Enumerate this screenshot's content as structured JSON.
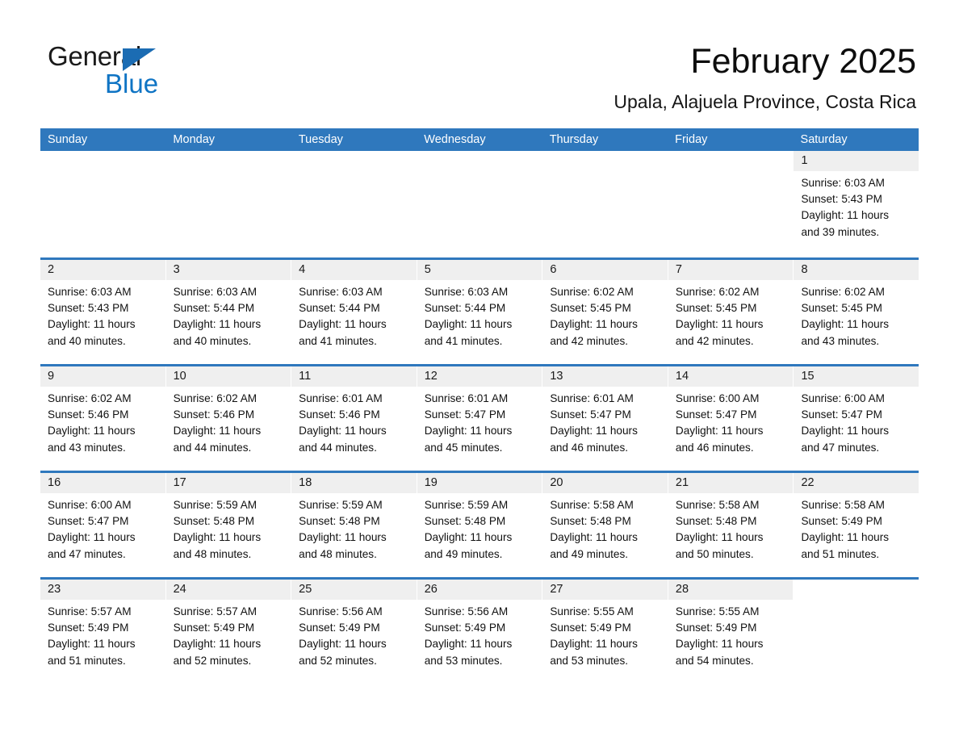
{
  "brand": {
    "name_part1": "General",
    "name_part2": "Blue",
    "triangle_icon": "triangle-icon",
    "accent_color": "#1b6cb3",
    "blue_text_color": "#0f74c4"
  },
  "header": {
    "month_title": "February 2025",
    "location": "Upala, Alajuela Province, Costa Rica"
  },
  "theme": {
    "header_blue": "#2f78bd",
    "day_band_gray": "#efefef",
    "cell_white": "#ffffff",
    "text_color": "#1a1a1a"
  },
  "weekdays": [
    "Sunday",
    "Monday",
    "Tuesday",
    "Wednesday",
    "Thursday",
    "Friday",
    "Saturday"
  ],
  "weeks": [
    [
      {
        "day": "",
        "lines": []
      },
      {
        "day": "",
        "lines": []
      },
      {
        "day": "",
        "lines": []
      },
      {
        "day": "",
        "lines": []
      },
      {
        "day": "",
        "lines": []
      },
      {
        "day": "",
        "lines": []
      },
      {
        "day": "1",
        "lines": [
          "Sunrise: 6:03 AM",
          "Sunset: 5:43 PM",
          "Daylight: 11 hours",
          "and 39 minutes."
        ]
      }
    ],
    [
      {
        "day": "2",
        "lines": [
          "Sunrise: 6:03 AM",
          "Sunset: 5:43 PM",
          "Daylight: 11 hours",
          "and 40 minutes."
        ]
      },
      {
        "day": "3",
        "lines": [
          "Sunrise: 6:03 AM",
          "Sunset: 5:44 PM",
          "Daylight: 11 hours",
          "and 40 minutes."
        ]
      },
      {
        "day": "4",
        "lines": [
          "Sunrise: 6:03 AM",
          "Sunset: 5:44 PM",
          "Daylight: 11 hours",
          "and 41 minutes."
        ]
      },
      {
        "day": "5",
        "lines": [
          "Sunrise: 6:03 AM",
          "Sunset: 5:44 PM",
          "Daylight: 11 hours",
          "and 41 minutes."
        ]
      },
      {
        "day": "6",
        "lines": [
          "Sunrise: 6:02 AM",
          "Sunset: 5:45 PM",
          "Daylight: 11 hours",
          "and 42 minutes."
        ]
      },
      {
        "day": "7",
        "lines": [
          "Sunrise: 6:02 AM",
          "Sunset: 5:45 PM",
          "Daylight: 11 hours",
          "and 42 minutes."
        ]
      },
      {
        "day": "8",
        "lines": [
          "Sunrise: 6:02 AM",
          "Sunset: 5:45 PM",
          "Daylight: 11 hours",
          "and 43 minutes."
        ]
      }
    ],
    [
      {
        "day": "9",
        "lines": [
          "Sunrise: 6:02 AM",
          "Sunset: 5:46 PM",
          "Daylight: 11 hours",
          "and 43 minutes."
        ]
      },
      {
        "day": "10",
        "lines": [
          "Sunrise: 6:02 AM",
          "Sunset: 5:46 PM",
          "Daylight: 11 hours",
          "and 44 minutes."
        ]
      },
      {
        "day": "11",
        "lines": [
          "Sunrise: 6:01 AM",
          "Sunset: 5:46 PM",
          "Daylight: 11 hours",
          "and 44 minutes."
        ]
      },
      {
        "day": "12",
        "lines": [
          "Sunrise: 6:01 AM",
          "Sunset: 5:47 PM",
          "Daylight: 11 hours",
          "and 45 minutes."
        ]
      },
      {
        "day": "13",
        "lines": [
          "Sunrise: 6:01 AM",
          "Sunset: 5:47 PM",
          "Daylight: 11 hours",
          "and 46 minutes."
        ]
      },
      {
        "day": "14",
        "lines": [
          "Sunrise: 6:00 AM",
          "Sunset: 5:47 PM",
          "Daylight: 11 hours",
          "and 46 minutes."
        ]
      },
      {
        "day": "15",
        "lines": [
          "Sunrise: 6:00 AM",
          "Sunset: 5:47 PM",
          "Daylight: 11 hours",
          "and 47 minutes."
        ]
      }
    ],
    [
      {
        "day": "16",
        "lines": [
          "Sunrise: 6:00 AM",
          "Sunset: 5:47 PM",
          "Daylight: 11 hours",
          "and 47 minutes."
        ]
      },
      {
        "day": "17",
        "lines": [
          "Sunrise: 5:59 AM",
          "Sunset: 5:48 PM",
          "Daylight: 11 hours",
          "and 48 minutes."
        ]
      },
      {
        "day": "18",
        "lines": [
          "Sunrise: 5:59 AM",
          "Sunset: 5:48 PM",
          "Daylight: 11 hours",
          "and 48 minutes."
        ]
      },
      {
        "day": "19",
        "lines": [
          "Sunrise: 5:59 AM",
          "Sunset: 5:48 PM",
          "Daylight: 11 hours",
          "and 49 minutes."
        ]
      },
      {
        "day": "20",
        "lines": [
          "Sunrise: 5:58 AM",
          "Sunset: 5:48 PM",
          "Daylight: 11 hours",
          "and 49 minutes."
        ]
      },
      {
        "day": "21",
        "lines": [
          "Sunrise: 5:58 AM",
          "Sunset: 5:48 PM",
          "Daylight: 11 hours",
          "and 50 minutes."
        ]
      },
      {
        "day": "22",
        "lines": [
          "Sunrise: 5:58 AM",
          "Sunset: 5:49 PM",
          "Daylight: 11 hours",
          "and 51 minutes."
        ]
      }
    ],
    [
      {
        "day": "23",
        "lines": [
          "Sunrise: 5:57 AM",
          "Sunset: 5:49 PM",
          "Daylight: 11 hours",
          "and 51 minutes."
        ]
      },
      {
        "day": "24",
        "lines": [
          "Sunrise: 5:57 AM",
          "Sunset: 5:49 PM",
          "Daylight: 11 hours",
          "and 52 minutes."
        ]
      },
      {
        "day": "25",
        "lines": [
          "Sunrise: 5:56 AM",
          "Sunset: 5:49 PM",
          "Daylight: 11 hours",
          "and 52 minutes."
        ]
      },
      {
        "day": "26",
        "lines": [
          "Sunrise: 5:56 AM",
          "Sunset: 5:49 PM",
          "Daylight: 11 hours",
          "and 53 minutes."
        ]
      },
      {
        "day": "27",
        "lines": [
          "Sunrise: 5:55 AM",
          "Sunset: 5:49 PM",
          "Daylight: 11 hours",
          "and 53 minutes."
        ]
      },
      {
        "day": "28",
        "lines": [
          "Sunrise: 5:55 AM",
          "Sunset: 5:49 PM",
          "Daylight: 11 hours",
          "and 54 minutes."
        ]
      },
      {
        "day": "",
        "lines": []
      }
    ]
  ]
}
